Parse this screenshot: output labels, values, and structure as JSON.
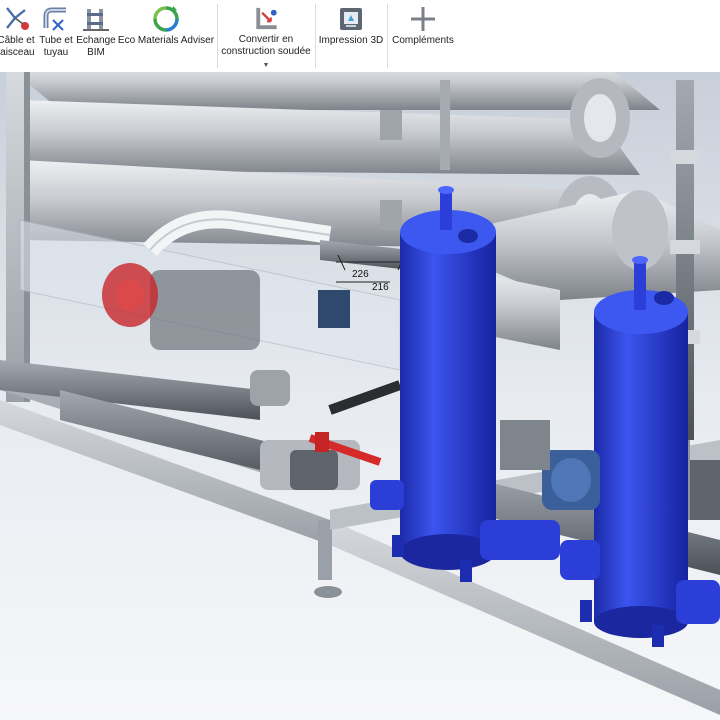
{
  "ribbon": {
    "items": [
      {
        "label": "Câble et\nfaisceau",
        "icon": "cable-harness-icon"
      },
      {
        "label": "Tube et\ntuyau",
        "icon": "tube-pipe-icon"
      },
      {
        "label": "Echange\nBIM",
        "icon": "bim-exchange-icon"
      },
      {
        "label": "Eco Materials Adviser",
        "icon": "eco-materials-icon"
      },
      {
        "label": "Convertir en\nconstruction soudée",
        "icon": "weldment-convert-icon"
      },
      {
        "label": "Impression 3D",
        "icon": "3d-print-icon"
      },
      {
        "label": "Compléments",
        "icon": "add-ins-icon"
      }
    ]
  },
  "viewport": {
    "dimensions": [
      "226",
      "216"
    ]
  },
  "colors": {
    "ribbon_bg": "#ffffff",
    "viewport_bg": "#e9edf3",
    "frame": "#b7bcc2",
    "pipe": "#c4c7cc",
    "vessel": "#2a3fd6",
    "valve_red": "#d42a2a"
  }
}
